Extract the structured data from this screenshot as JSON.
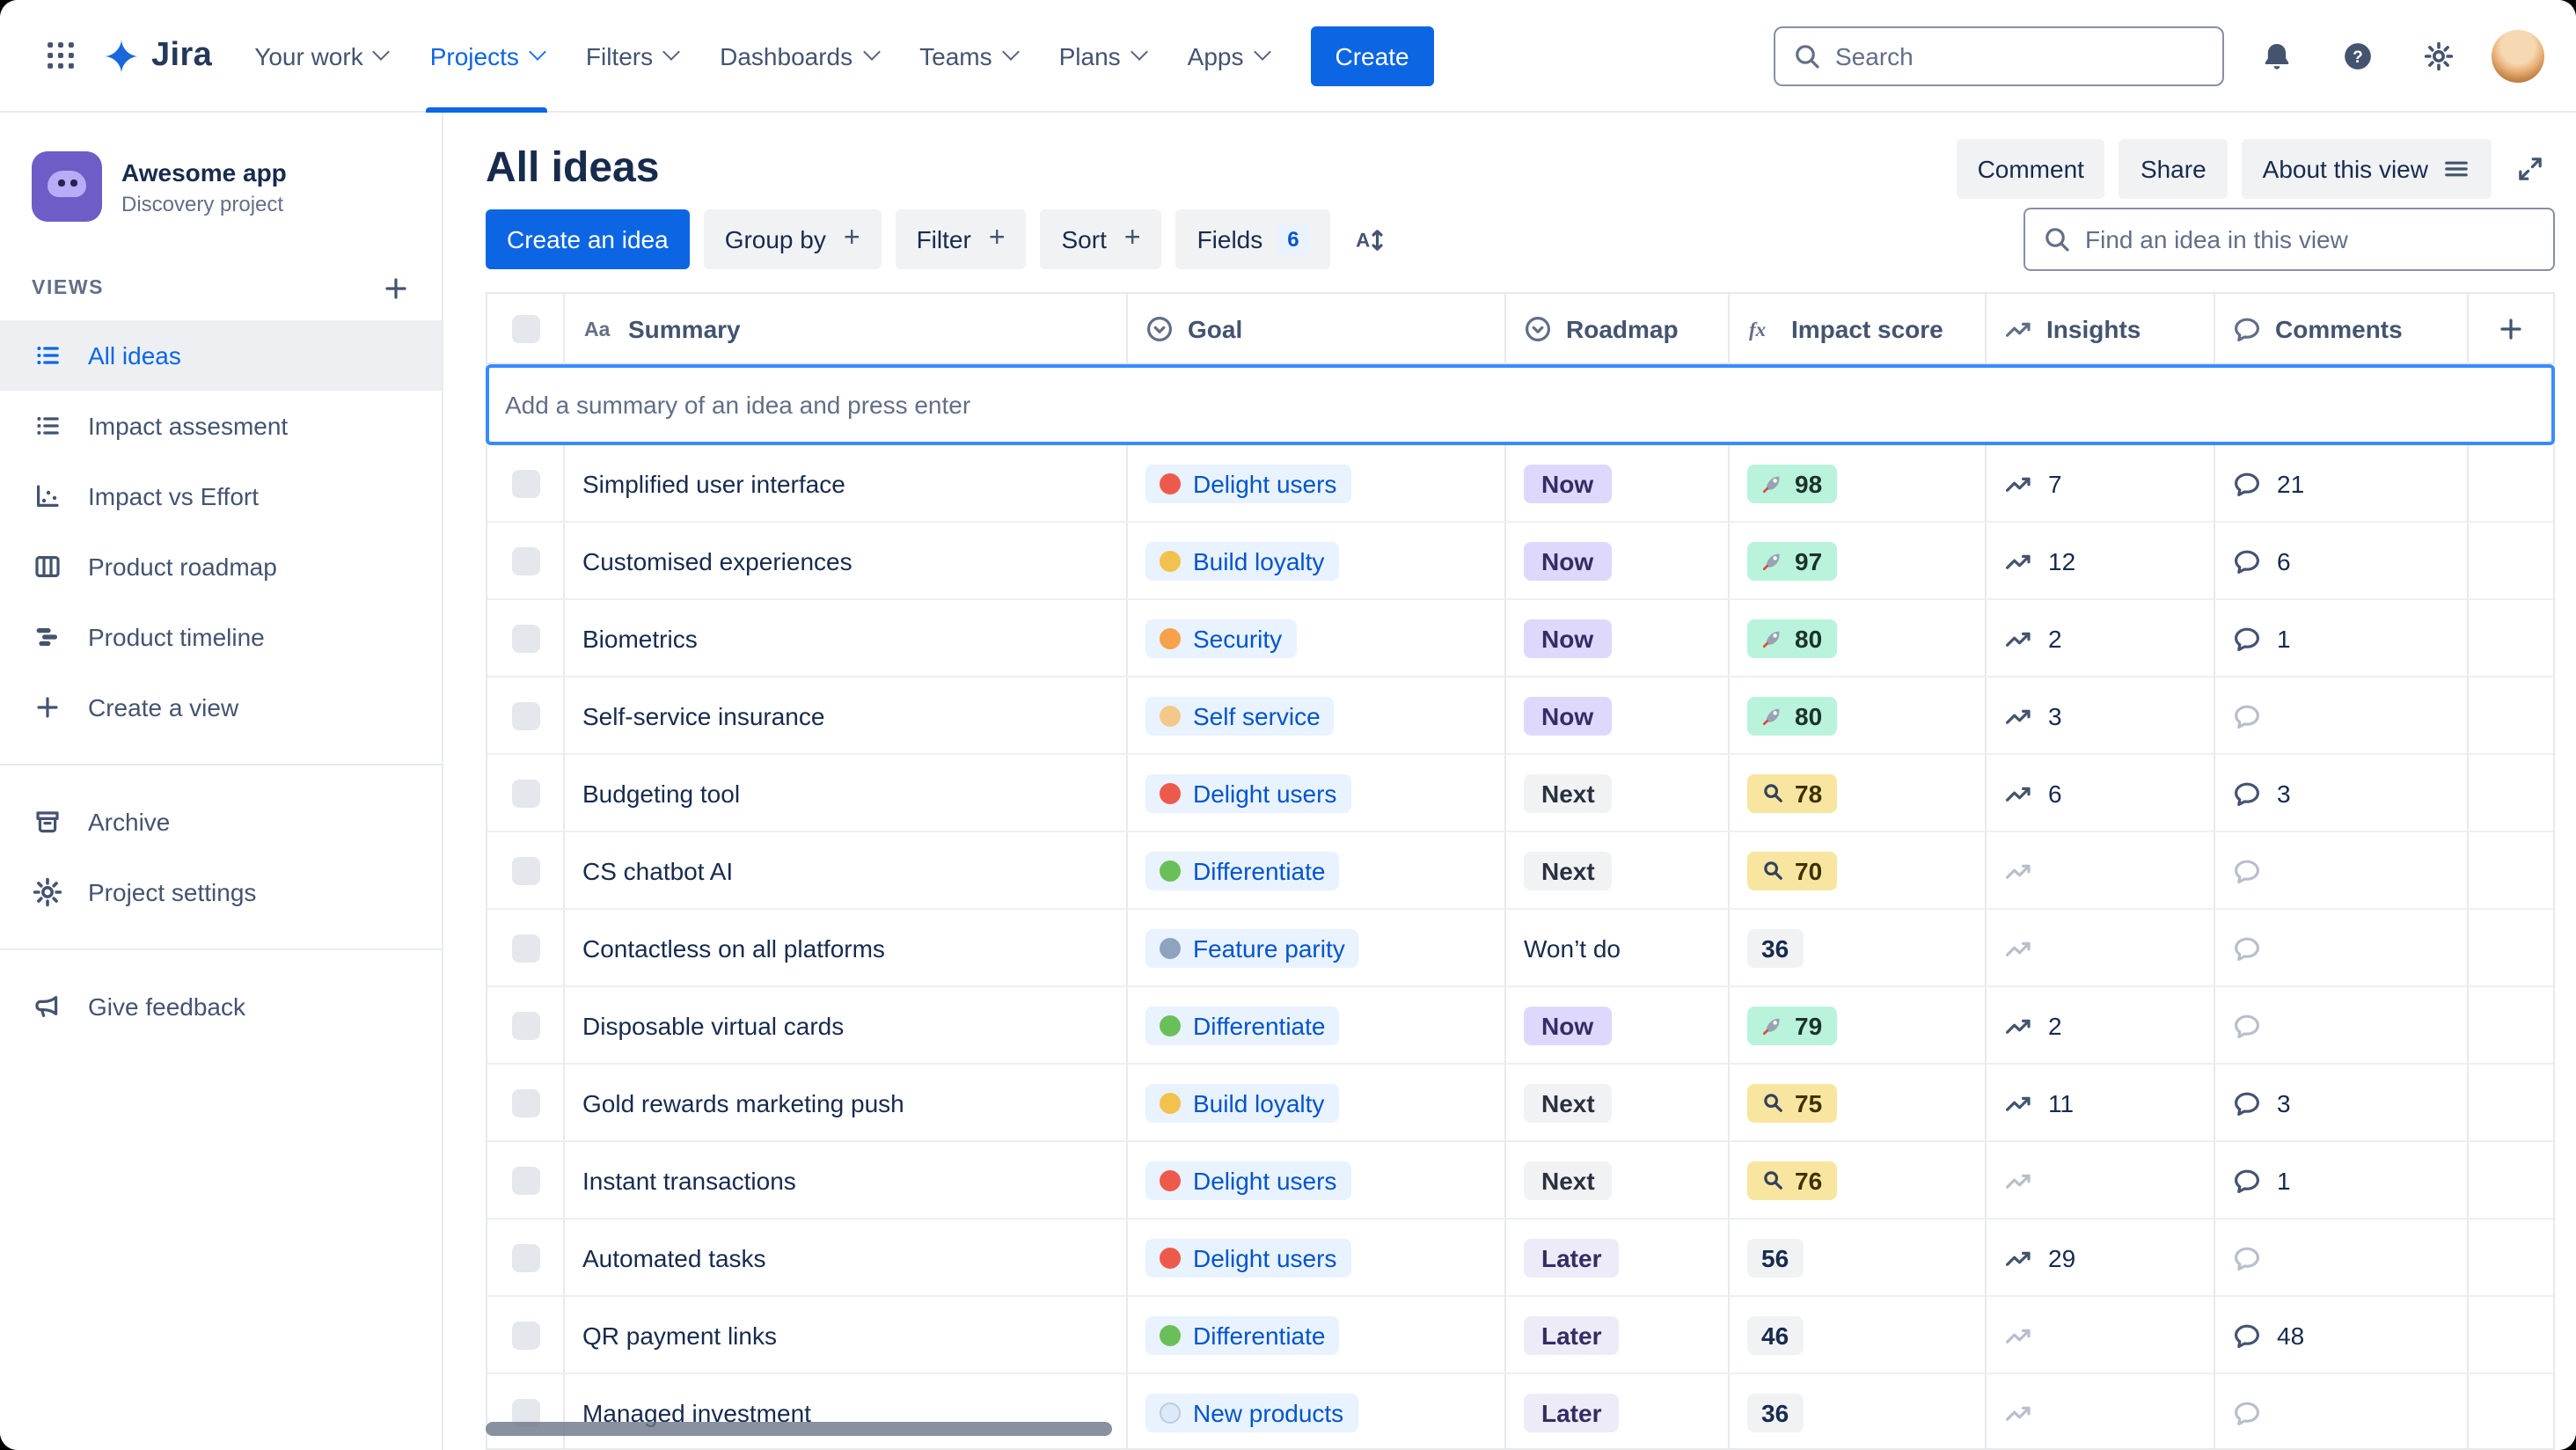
{
  "nav": {
    "logo_label": "Jira",
    "items": [
      "Your work",
      "Projects",
      "Filters",
      "Dashboards",
      "Teams",
      "Plans",
      "Apps"
    ],
    "active_item": "Projects",
    "create_label": "Create",
    "search_placeholder": "Search"
  },
  "sidebar": {
    "project_name": "Awesome app",
    "project_type": "Discovery project",
    "views_label": "VIEWS",
    "views": [
      {
        "label": "All ideas",
        "icon": "list-view-icon",
        "selected": true
      },
      {
        "label": "Impact assesment",
        "icon": "list-view-icon",
        "selected": false
      },
      {
        "label": "Impact vs Effort",
        "icon": "matrix-view-icon",
        "selected": false
      },
      {
        "label": "Product roadmap",
        "icon": "board-view-icon",
        "selected": false
      },
      {
        "label": "Product timeline",
        "icon": "timeline-view-icon",
        "selected": false
      },
      {
        "label": "Create a view",
        "icon": "plus-icon",
        "selected": false
      }
    ],
    "tools": [
      {
        "label": "Archive",
        "icon": "archive-icon"
      },
      {
        "label": "Project settings",
        "icon": "gear-icon"
      }
    ],
    "feedback_label": "Give feedback",
    "feedback_icon": "megaphone-icon"
  },
  "view_header": {
    "title": "All ideas",
    "comment_label": "Comment",
    "share_label": "Share",
    "about_label": "About this view"
  },
  "toolbar": {
    "create_idea_label": "Create an idea",
    "group_by_label": "Group by",
    "filter_label": "Filter",
    "sort_label": "Sort",
    "fields_label": "Fields",
    "fields_count": "6",
    "find_placeholder": "Find an idea in this view"
  },
  "table": {
    "add_placeholder": "Add a summary of an idea and press enter",
    "columns": [
      {
        "key": "summary",
        "label": "Summary",
        "icon": "text-style-icon"
      },
      {
        "key": "goal",
        "label": "Goal",
        "icon": "select-circle-icon"
      },
      {
        "key": "roadmap",
        "label": "Roadmap",
        "icon": "select-circle-icon"
      },
      {
        "key": "impact",
        "label": "Impact score",
        "icon": "formula-icon"
      },
      {
        "key": "insights",
        "label": "Insights",
        "icon": "trend-icon"
      },
      {
        "key": "comments",
        "label": "Comments",
        "icon": "comment-icon"
      }
    ],
    "rows": [
      {
        "summary": "Simplified user interface",
        "goal": {
          "label": "Delight users",
          "icon": "heart-eyes-emoji"
        },
        "roadmap": {
          "label": "Now",
          "variant": "now"
        },
        "impact": {
          "score": "98",
          "level": "high"
        },
        "insights": "7",
        "comments": "21"
      },
      {
        "summary": "Customised experiences",
        "goal": {
          "label": "Build loyalty",
          "icon": "handshake-emoji"
        },
        "roadmap": {
          "label": "Now",
          "variant": "now"
        },
        "impact": {
          "score": "97",
          "level": "high"
        },
        "insights": "12",
        "comments": "6"
      },
      {
        "summary": "Biometrics",
        "goal": {
          "label": "Security",
          "icon": "locked-with-key-emoji"
        },
        "roadmap": {
          "label": "Now",
          "variant": "now"
        },
        "impact": {
          "score": "80",
          "level": "high"
        },
        "insights": "2",
        "comments": "1"
      },
      {
        "summary": "Self-service insurance",
        "goal": {
          "label": "Self service",
          "icon": "selfie-emoji"
        },
        "roadmap": {
          "label": "Now",
          "variant": "now"
        },
        "impact": {
          "score": "80",
          "level": "high"
        },
        "insights": "3",
        "comments": ""
      },
      {
        "summary": "Budgeting tool",
        "goal": {
          "label": "Delight users",
          "icon": "heart-eyes-emoji"
        },
        "roadmap": {
          "label": "Next",
          "variant": "next"
        },
        "impact": {
          "score": "78",
          "level": "medium"
        },
        "insights": "6",
        "comments": "3"
      },
      {
        "summary": "CS chatbot AI",
        "goal": {
          "label": "Differentiate",
          "icon": "green-crayon-emoji"
        },
        "roadmap": {
          "label": "Next",
          "variant": "next"
        },
        "impact": {
          "score": "70",
          "level": "medium"
        },
        "insights": "",
        "comments": ""
      },
      {
        "summary": "Contactless on all platforms",
        "goal": {
          "label": "Feature parity",
          "icon": "car-emoji"
        },
        "roadmap": {
          "label": "Won’t do",
          "variant": "plain"
        },
        "impact": {
          "score": "36",
          "level": "low"
        },
        "insights": "",
        "comments": ""
      },
      {
        "summary": "Disposable virtual cards",
        "goal": {
          "label": "Differentiate",
          "icon": "green-crayon-emoji"
        },
        "roadmap": {
          "label": "Now",
          "variant": "now"
        },
        "impact": {
          "score": "79",
          "level": "high"
        },
        "insights": "2",
        "comments": ""
      },
      {
        "summary": "Gold rewards marketing push",
        "goal": {
          "label": "Build loyalty",
          "icon": "handshake-emoji"
        },
        "roadmap": {
          "label": "Next",
          "variant": "next"
        },
        "impact": {
          "score": "75",
          "level": "medium"
        },
        "insights": "11",
        "comments": "3"
      },
      {
        "summary": "Instant transactions",
        "goal": {
          "label": "Delight users",
          "icon": "heart-eyes-emoji"
        },
        "roadmap": {
          "label": "Next",
          "variant": "next"
        },
        "impact": {
          "score": "76",
          "level": "medium"
        },
        "insights": "",
        "comments": "1"
      },
      {
        "summary": "Automated tasks",
        "goal": {
          "label": "Delight users",
          "icon": "heart-eyes-emoji"
        },
        "roadmap": {
          "label": "Later",
          "variant": "later"
        },
        "impact": {
          "score": "56",
          "level": "low"
        },
        "insights": "29",
        "comments": ""
      },
      {
        "summary": "QR payment links",
        "goal": {
          "label": "Differentiate",
          "icon": "green-crayon-emoji"
        },
        "roadmap": {
          "label": "Later",
          "variant": "later"
        },
        "impact": {
          "score": "46",
          "level": "low"
        },
        "insights": "",
        "comments": "48"
      },
      {
        "summary": "Managed investment",
        "goal": {
          "label": "New products",
          "icon": "bubble-emoji"
        },
        "roadmap": {
          "label": "Later",
          "variant": "later"
        },
        "impact": {
          "score": "36",
          "level": "low"
        },
        "insights": "",
        "comments": ""
      }
    ]
  },
  "colors": {
    "accent_blue": "#0C66E4",
    "focus_border": "#388BFF",
    "goal_chip_bg": "#E9F2FF",
    "goal_chip_text": "#0055CC",
    "roadmap_now_bg": "#DFD8FD",
    "roadmap_next_bg": "#F1F2F4",
    "roadmap_later_bg": "#EDEBF7",
    "impact_high_bg": "#BAF3DB",
    "impact_medium_bg": "#F8E6A0",
    "impact_low_bg": "#F1F2F4"
  }
}
